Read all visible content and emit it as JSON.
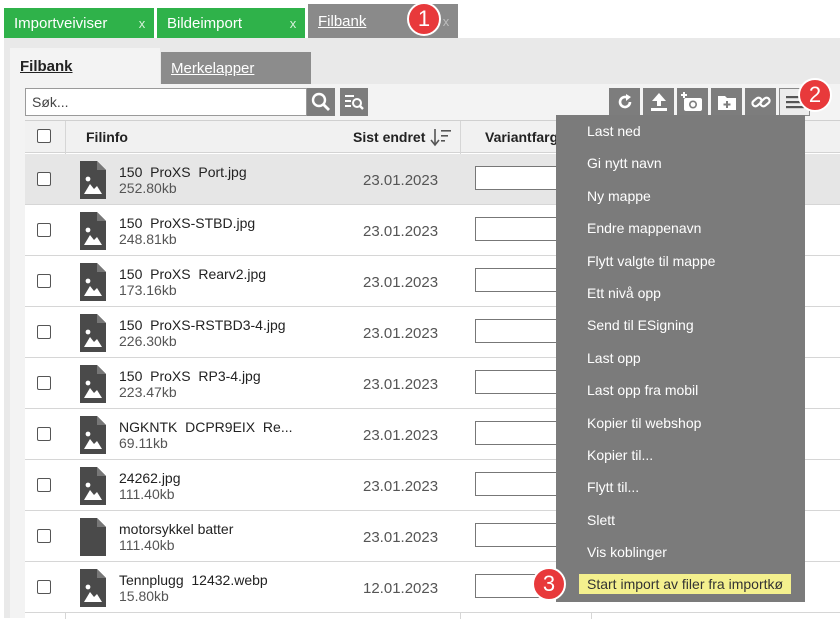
{
  "top_tabs": [
    {
      "label": "Importveiviser",
      "close": "x"
    },
    {
      "label": "Bildeimport",
      "close": "x"
    },
    {
      "label": "Filbank",
      "close": "x"
    }
  ],
  "sub_tabs": {
    "active": "Filbank",
    "inactive": "Merkelapper"
  },
  "search": {
    "placeholder": "Søk..."
  },
  "icons": {
    "search": "search-icon",
    "advanced_search": "advanced-search-icon",
    "refresh": "refresh-icon",
    "upload": "upload-icon",
    "camera": "camera-add-icon",
    "folder": "new-folder-icon",
    "link": "link-icon",
    "menu": "hamburger-menu-icon"
  },
  "table": {
    "headers": {
      "fileinfo": "Filinfo",
      "date": "Sist endret",
      "variant": "Variantfarge"
    },
    "rows": [
      {
        "name": "150  ProXS  Port.jpg",
        "size": "252.80kb",
        "date": "23.01.2023",
        "icon": "image-file-icon",
        "selected": true
      },
      {
        "name": "150  ProXS-STBD.jpg",
        "size": "248.81kb",
        "date": "23.01.2023",
        "icon": "image-file-icon"
      },
      {
        "name": "150  ProXS  Rearv2.jpg",
        "size": "173.16kb",
        "date": "23.01.2023",
        "icon": "image-file-icon"
      },
      {
        "name": "150  ProXS-RSTBD3-4.jpg",
        "size": "226.30kb",
        "date": "23.01.2023",
        "icon": "image-file-icon"
      },
      {
        "name": "150  ProXS  RP3-4.jpg",
        "size": "223.47kb",
        "date": "23.01.2023",
        "icon": "image-file-icon"
      },
      {
        "name": "NGKNTK  DCPR9EIX  Re...",
        "size": "69.11kb",
        "date": "23.01.2023",
        "icon": "image-file-icon"
      },
      {
        "name": "24262.jpg",
        "size": "111.40kb",
        "date": "23.01.2023",
        "icon": "image-file-icon"
      },
      {
        "name": "motorsykkel batter",
        "size": "111.40kb",
        "date": "23.01.2023",
        "icon": "blank-file-icon"
      },
      {
        "name": "Tennplugg  12432.webp",
        "size": "15.80kb",
        "date": "12.01.2023",
        "icon": "image-file-icon"
      }
    ]
  },
  "menu": {
    "items": [
      "Last ned",
      "Gi nytt navn",
      "Ny mappe",
      "Endre mappenavn",
      "Flytt valgte til mappe",
      "Ett nivå opp",
      "Send til ESigning",
      "Last opp",
      "Last opp fra mobil",
      "Kopier til webshop",
      "Kopier til...",
      "Flytt til...",
      "Slett",
      "Vis koblinger",
      "Start import av filer fra importkø"
    ]
  },
  "badges": [
    "1",
    "2",
    "3"
  ],
  "colors": {
    "tab_green": "#2fb24a",
    "tab_grey": "#8a8a8a",
    "toolbar": "#7d7d7d",
    "menu_bg": "#7b7b7b",
    "highlight": "#f4f08e",
    "badge": "#e8393b"
  }
}
